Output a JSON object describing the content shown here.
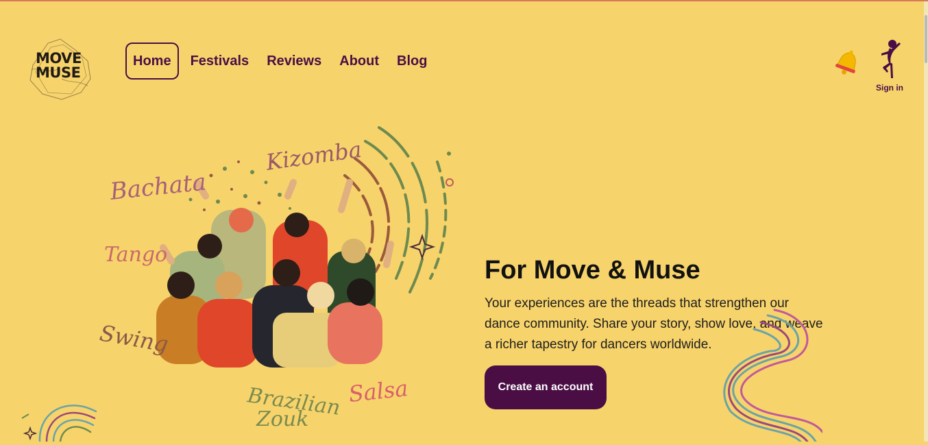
{
  "brand": {
    "logo_line1": "MOVE",
    "logo_line2": "MUSE"
  },
  "nav": {
    "items": [
      "Home",
      "Festivals",
      "Reviews",
      "About",
      "Blog"
    ],
    "active": "Home"
  },
  "header": {
    "signin_label": "Sign in"
  },
  "hero": {
    "headline": "For Move & Muse",
    "body": "Your experiences are the threads that strengthen our dance community. Share your story, show love, and weave a richer tapestry for dancers worldwide.",
    "cta_label": "Create an account",
    "dance_styles": [
      "Bachata",
      "Kizomba",
      "Tango",
      "Swing",
      "Brazilian",
      "Zouk",
      "Salsa"
    ]
  },
  "colors": {
    "background": "#f7d36b",
    "accent": "#4a0e45",
    "cta_text": "#ffffff"
  }
}
